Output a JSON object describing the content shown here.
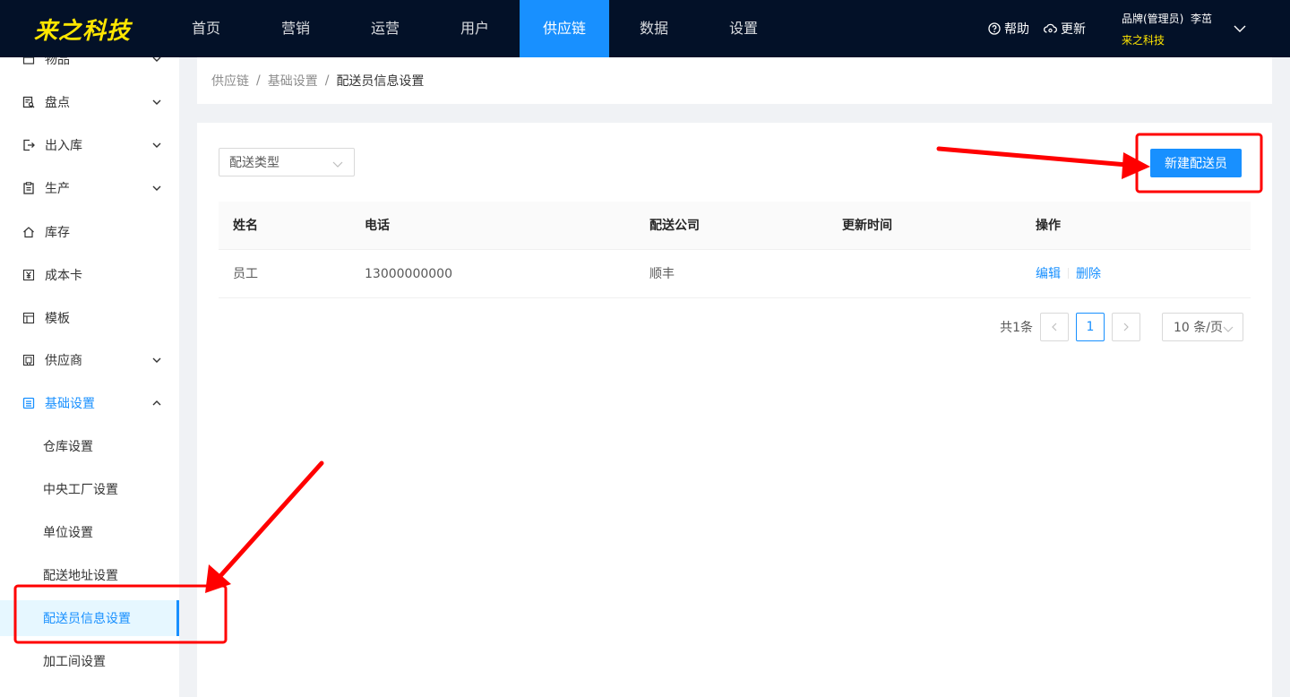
{
  "header": {
    "logo": "来之科技",
    "nav": [
      "首页",
      "营销",
      "运营",
      "用户",
      "供应链",
      "数据",
      "设置"
    ],
    "active_nav": "供应链",
    "help": "帮助",
    "update": "更新",
    "user_role": "品牌(管理员)",
    "user_name": "李茁",
    "company": "来之科技"
  },
  "sidebar": {
    "items": [
      {
        "label": "物品",
        "icon": "box-icon",
        "arrow": "down"
      },
      {
        "label": "盘点",
        "icon": "inventory-check-icon",
        "arrow": "down"
      },
      {
        "label": "出入库",
        "icon": "in-out-icon",
        "arrow": "down"
      },
      {
        "label": "生产",
        "icon": "clipboard-icon",
        "arrow": "down"
      },
      {
        "label": "库存",
        "icon": "home-icon",
        "arrow": ""
      },
      {
        "label": "成本卡",
        "icon": "yen-icon",
        "arrow": ""
      },
      {
        "label": "模板",
        "icon": "layout-icon",
        "arrow": ""
      },
      {
        "label": "供应商",
        "icon": "building-icon",
        "arrow": "down"
      },
      {
        "label": "基础设置",
        "icon": "list-icon",
        "arrow": "up"
      }
    ],
    "sub_items": [
      "仓库设置",
      "中央工厂设置",
      "单位设置",
      "配送地址设置",
      "配送员信息设置",
      "加工间设置"
    ],
    "selected_sub": "配送员信息设置"
  },
  "breadcrumb": {
    "level1": "供应链",
    "level2": "基础设置",
    "current": "配送员信息设置",
    "separator": "/"
  },
  "toolbar": {
    "filter_placeholder": "配送类型",
    "new_button": "新建配送员"
  },
  "table": {
    "columns": [
      "姓名",
      "电话",
      "配送公司",
      "更新时间",
      "操作"
    ],
    "rows": [
      {
        "name": "员工",
        "phone": "13000000000",
        "company": "顺丰",
        "updated": "",
        "edit": "编辑",
        "delete": "删除"
      }
    ]
  },
  "pagination": {
    "total": "共1条",
    "current_page": "1",
    "page_size": "10 条/页"
  },
  "colors": {
    "topbar": "#031128",
    "primary": "#1890ff",
    "logo": "#ffe600",
    "annotation": "#ff0000"
  }
}
